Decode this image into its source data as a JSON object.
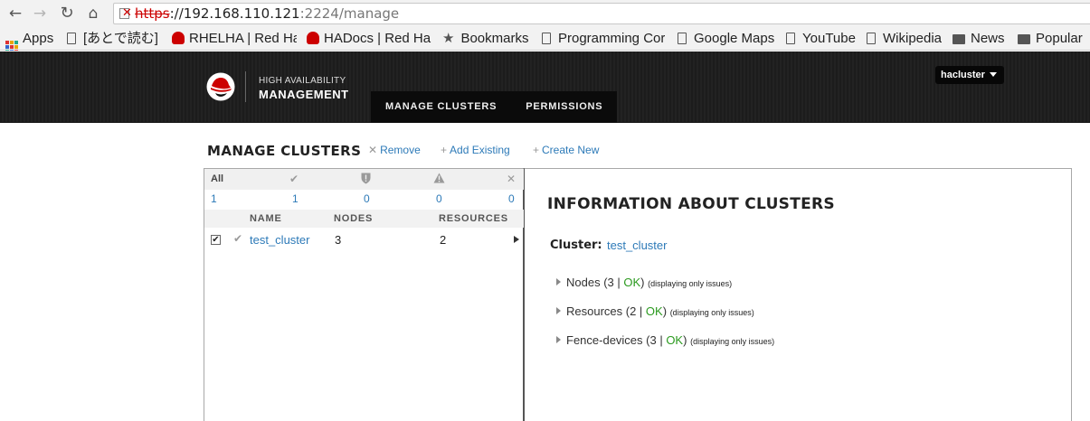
{
  "browser": {
    "url_scheme": "https",
    "url_host": "://192.168.110.121",
    "url_rest": ":2224/manage",
    "bookmarks": [
      {
        "label": "Apps",
        "icon": "apps-grid-icon"
      },
      {
        "label": "[あとで読む]",
        "icon": "page-icon"
      },
      {
        "label": "RHELHA | Red Ha",
        "icon": "redhat-icon"
      },
      {
        "label": "HADocs | Red Ha",
        "icon": "redhat-icon"
      },
      {
        "label": "Bookmarks",
        "icon": "star-icon"
      },
      {
        "label": "Programming Cor",
        "icon": "page-icon"
      },
      {
        "label": "Google Maps",
        "icon": "page-icon"
      },
      {
        "label": "YouTube",
        "icon": "page-icon"
      },
      {
        "label": "Wikipedia",
        "icon": "page-icon"
      },
      {
        "label": "News",
        "icon": "folder-icon"
      },
      {
        "label": "Popular",
        "icon": "folder-icon"
      }
    ]
  },
  "header": {
    "brand_line1": "HIGH AVAILABILITY",
    "brand_line2": "MANAGEMENT",
    "tabs": [
      "MANAGE CLUSTERS",
      "PERMISSIONS"
    ],
    "user": "hacluster"
  },
  "page": {
    "title": "MANAGE CLUSTERS",
    "actions": {
      "remove": "Remove",
      "add_existing": "Add Existing",
      "create_new": "Create New"
    }
  },
  "filter": {
    "all_label": "All",
    "counts": {
      "all": "1",
      "ok": "1",
      "error": "0",
      "warning": "0",
      "unknown": "0"
    }
  },
  "table": {
    "headers": {
      "name": "NAME",
      "nodes": "NODES",
      "resources": "RESOURCES"
    },
    "rows": [
      {
        "name": "test_cluster",
        "nodes": "3",
        "resources": "2",
        "checked": true
      }
    ]
  },
  "info": {
    "title": "INFORMATION ABOUT CLUSTERS",
    "cluster_label": "Cluster:",
    "cluster_name": "test_cluster",
    "nodes": {
      "label": "Nodes (3 | ",
      "ok": "OK",
      "close": ")",
      "note": "(displaying only issues)"
    },
    "resources": {
      "label": "Resources (2 | ",
      "ok": "OK",
      "close": ")",
      "note": "(displaying only issues)"
    },
    "fences": {
      "label": "Fence-devices (3 | ",
      "ok": "OK",
      "close": ")",
      "note": "(displaying only issues)"
    }
  },
  "colors": {
    "accent": "#2d7ab8",
    "ok": "#2b9a1f",
    "header_bg": "#1c1c1c",
    "brand_red": "#cc0000"
  }
}
